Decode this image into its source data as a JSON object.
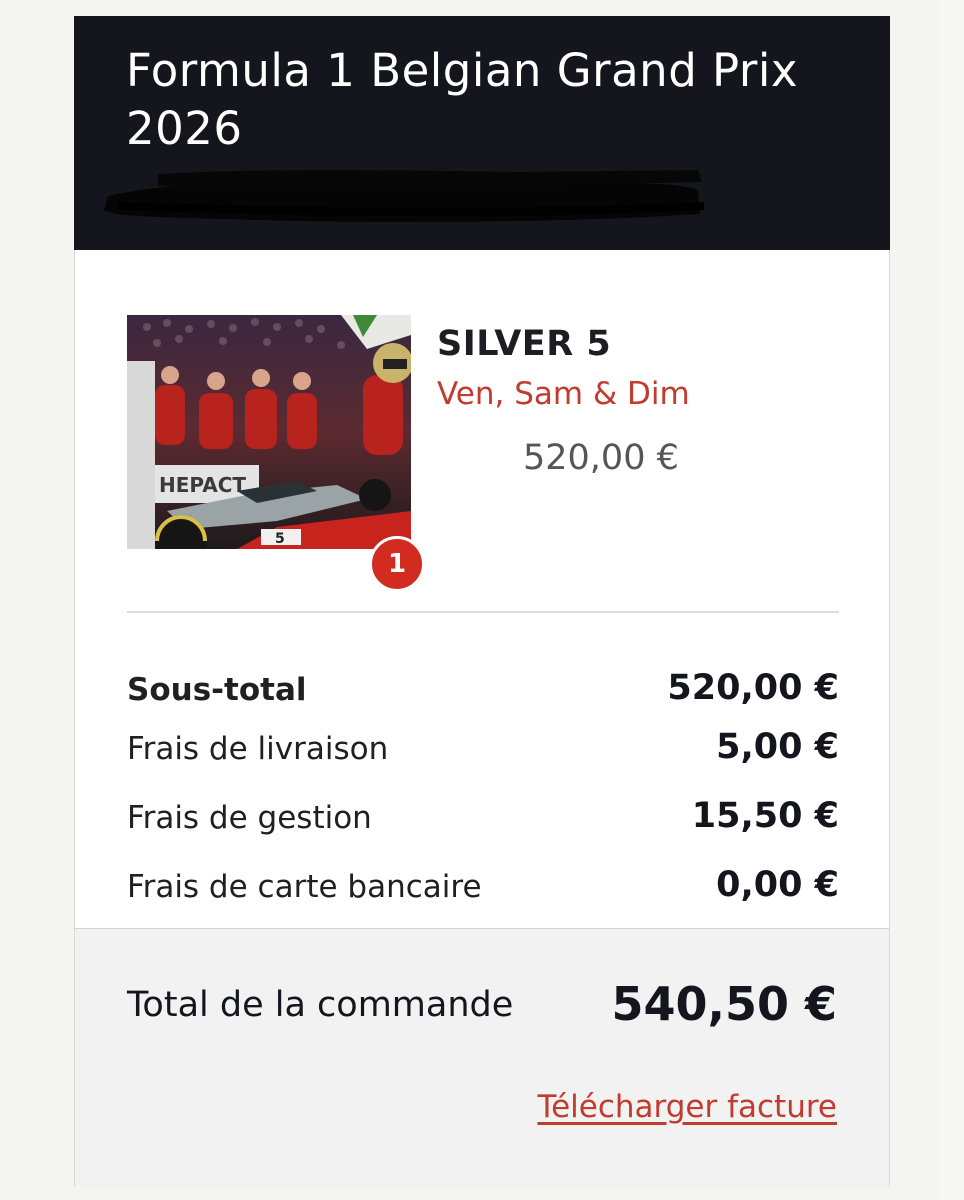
{
  "header": {
    "event_title": "Formula 1 Belgian Grand Prix 2026"
  },
  "product": {
    "name": "SILVER 5",
    "days": "Ven, Sam & Dim",
    "price": "520,00 €",
    "quantity": "1"
  },
  "summary": {
    "rows": [
      {
        "label": "Sous-total",
        "value": "520,00 €"
      },
      {
        "label": "Frais de livraison",
        "value": "5,00 €"
      },
      {
        "label": "Frais de gestion",
        "value": "15,50 €"
      },
      {
        "label": "Frais de carte bancaire",
        "value": "0,00 €"
      }
    ]
  },
  "total": {
    "label": "Total de la commande",
    "value": "540,50 €"
  },
  "actions": {
    "download_invoice": "Télécharger facture"
  },
  "colors": {
    "header_bg": "#15151e",
    "accent_red": "#c23b2e",
    "badge_red": "#d22b1f",
    "total_bg": "#f2f2f2"
  }
}
